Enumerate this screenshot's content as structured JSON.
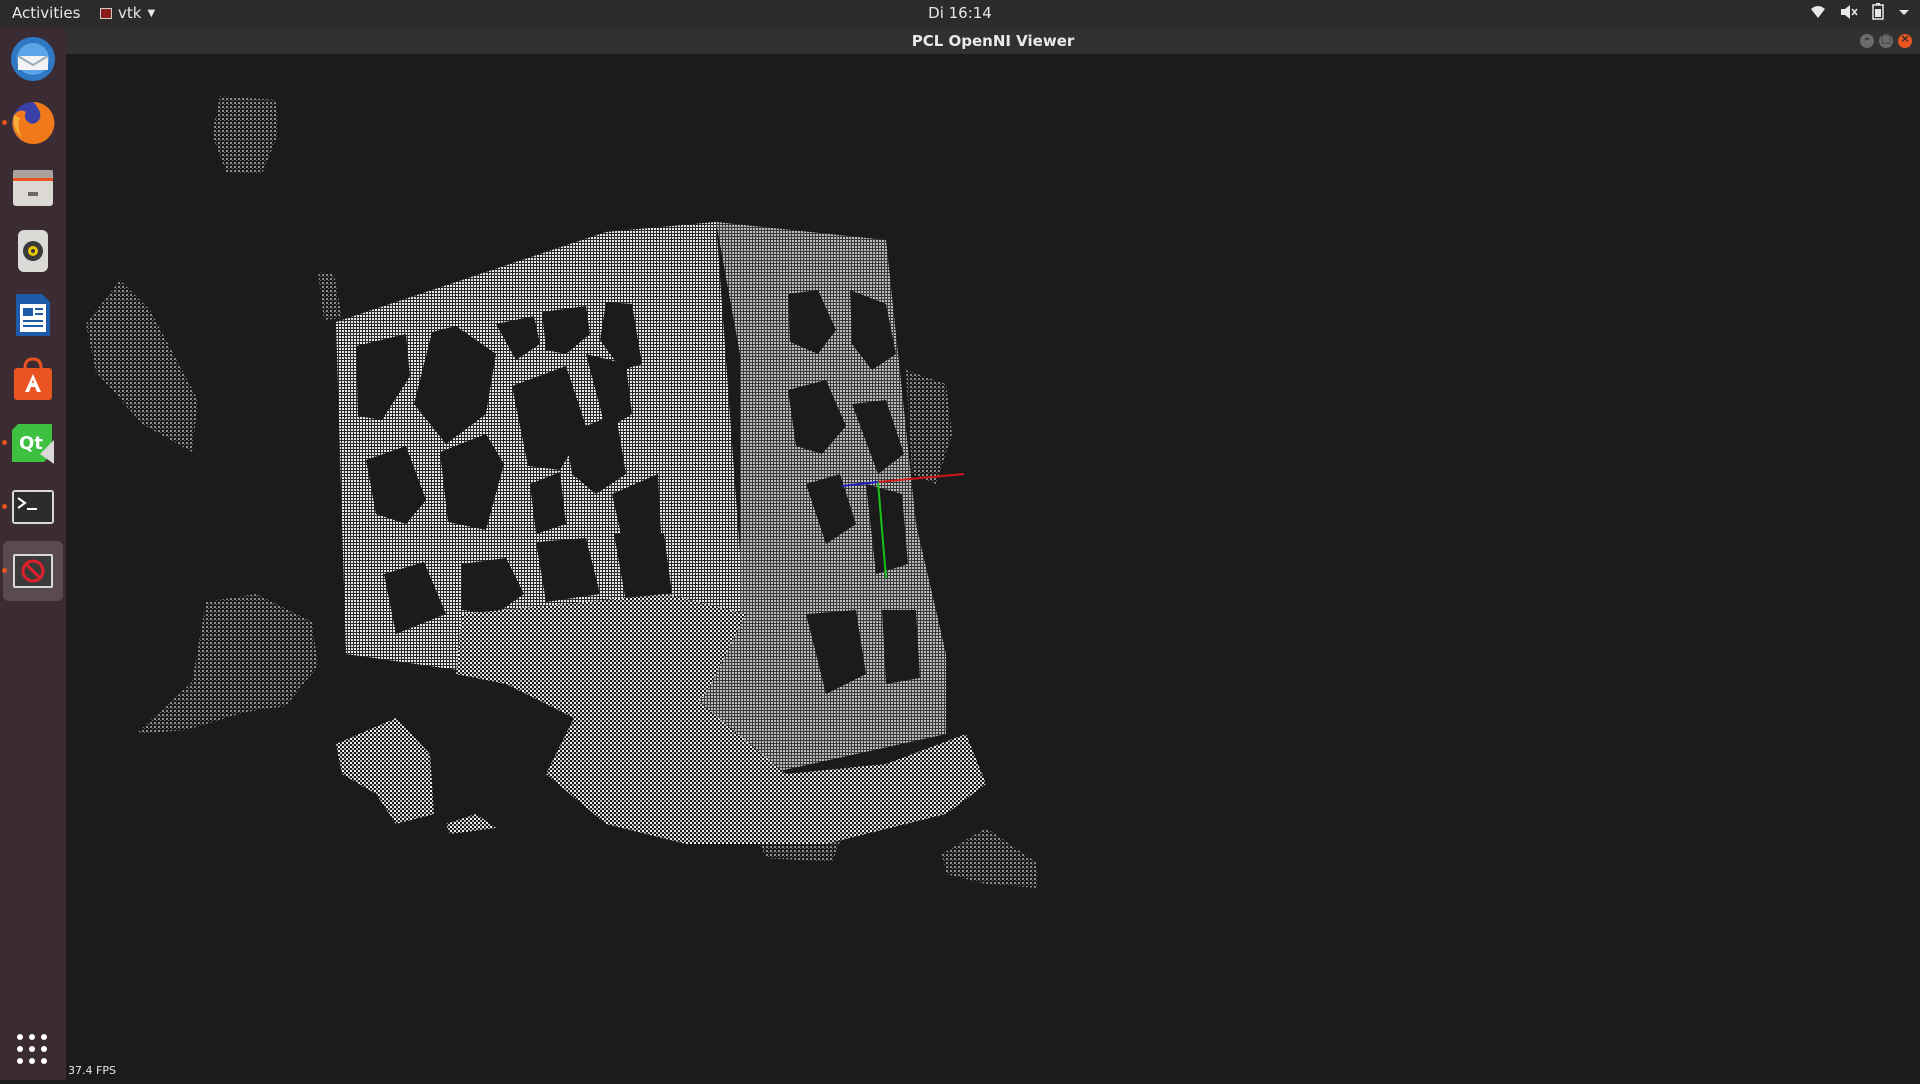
{
  "topbar": {
    "activities": "Activities",
    "app_name": "vtk",
    "clock": "Di 16:14",
    "tray_icons": [
      "wifi-icon",
      "volume-muted-icon",
      "battery-icon",
      "chevron-down-icon"
    ]
  },
  "dock": {
    "items": [
      {
        "name": "thunderbird",
        "icon": "mail-icon",
        "running": false
      },
      {
        "name": "firefox",
        "icon": "firefox-icon",
        "running": true
      },
      {
        "name": "files",
        "icon": "files-icon",
        "running": false
      },
      {
        "name": "rhythmbox",
        "icon": "speaker-icon",
        "running": false
      },
      {
        "name": "libreoffice-writer",
        "icon": "document-icon",
        "running": false
      },
      {
        "name": "ubuntu-software",
        "icon": "store-icon",
        "running": false
      },
      {
        "name": "qt-creator",
        "icon": "qt-icon",
        "running": true
      },
      {
        "name": "terminal",
        "icon": "terminal-icon",
        "running": true
      },
      {
        "name": "vtk-viewer",
        "icon": "no-entry-icon",
        "running": true
      }
    ],
    "show_apps_icon": "grid-icon"
  },
  "window": {
    "title": "PCL OpenNI Viewer",
    "fps": "37.4 FPS"
  },
  "axes_colors": {
    "x": "#d01818",
    "y": "#18c018",
    "z": "#2020c0"
  }
}
